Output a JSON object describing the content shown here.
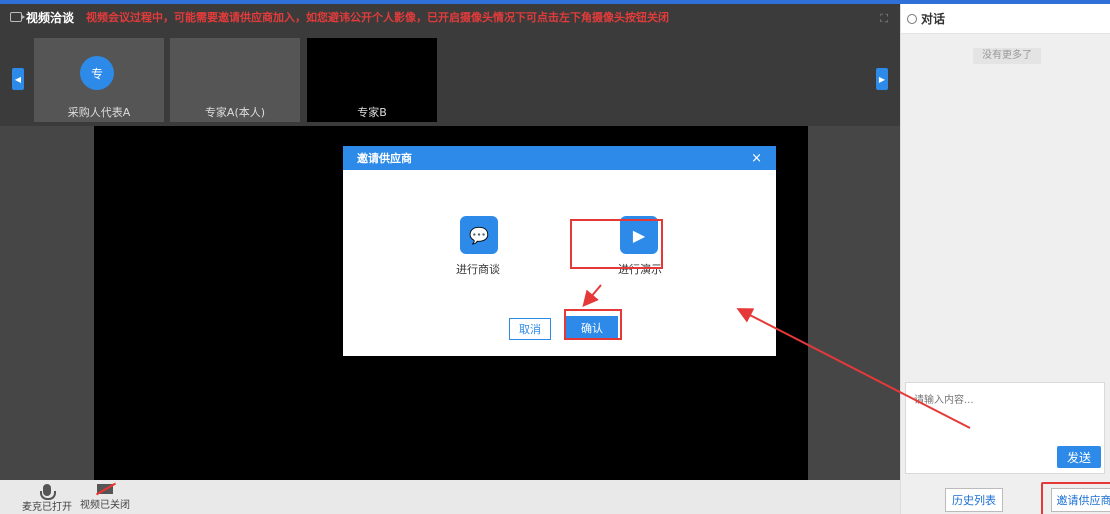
{
  "header": {
    "title": "视频洽谈",
    "notice": "视频会议过程中，可能需要邀请供应商加入，如您避讳公开个人影像，已开启摄像头情况下可点击左下角摄像头按钮关闭"
  },
  "participants": [
    {
      "name": "采购人代表A",
      "avatar_text": "专"
    },
    {
      "name": "专家A(本人)"
    },
    {
      "name": "专家B"
    }
  ],
  "controls": {
    "mic_label": "麦克已打开",
    "camera_label": "视频已关闭"
  },
  "chat": {
    "title": "对话",
    "no_more": "没有更多了",
    "input_placeholder": "请输入内容...",
    "send_label": "发送",
    "history_label": "历史列表",
    "invite_label": "邀请供应商"
  },
  "modal": {
    "title": "邀请供应商",
    "close": "×",
    "options": [
      {
        "label": "进行商谈",
        "icon": "chat-bubble-icon"
      },
      {
        "label": "进行演示",
        "icon": "presentation-icon"
      }
    ],
    "cancel_label": "取消",
    "confirm_label": "确认"
  },
  "colors": {
    "accent": "#2d8ae8",
    "highlight": "#e53939",
    "notice": "#e23b3b"
  }
}
